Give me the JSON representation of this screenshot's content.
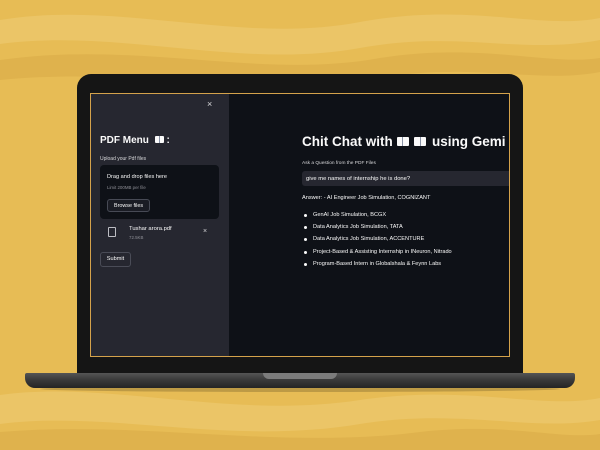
{
  "sidebar": {
    "close_icon": "×",
    "title": "PDF Menu",
    "title_suffix": ":",
    "upload_label": "Upload your Pdf files",
    "dropzone_title": "Drag and drop files here",
    "dropzone_limit": "Limit 200MB per file",
    "browse_label": "Browse files",
    "file": {
      "name": "Tushar arora.pdf",
      "size": "72.5KB"
    },
    "remove_icon": "×",
    "submit_label": "Submit"
  },
  "main": {
    "title": "Chit Chat with",
    "title_suffix": "using Gemi",
    "question_label": "Ask a Question from the PDF Files",
    "question_value": "give me names of internship he is done?",
    "answer_text": "Answer: - AI Engineer Job Simulation, COGNIZANT",
    "answer_items": [
      "GenAI Job Simulation, BCGX",
      "Data Analytics Job Simulation, TATA",
      "Data Analytics Job Simulation, ACCENTURE",
      "Project-Based & Assisting Internship in INeuron, Nitrado",
      "Program-Based Intern in Globalshala & Feynn Labs"
    ]
  },
  "colors": {
    "background": "#e7bc55",
    "app_bg": "#0e1117",
    "sidebar_bg": "#262730",
    "text": "#fafafa"
  },
  "icons": [
    "close-icon",
    "book-icon",
    "file-icon",
    "remove-file-icon"
  ]
}
